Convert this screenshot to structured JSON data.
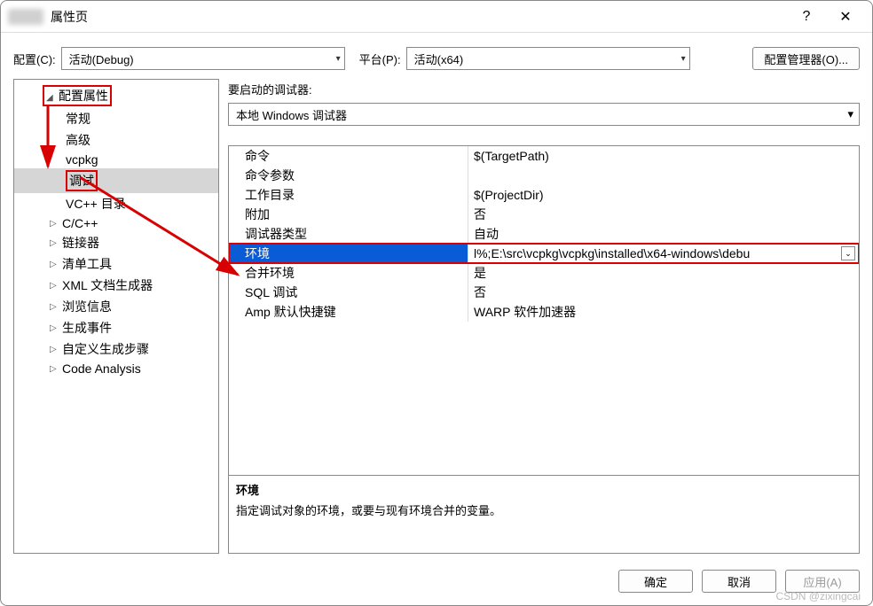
{
  "window": {
    "title": "属性页"
  },
  "toolbar": {
    "config_label": "配置(C):",
    "config_value": "活动(Debug)",
    "platform_label": "平台(P):",
    "platform_value": "活动(x64)",
    "config_mgr": "配置管理器(O)..."
  },
  "tree": {
    "root": "配置属性",
    "items": [
      {
        "label": "常规",
        "expandable": false
      },
      {
        "label": "高级",
        "expandable": false
      },
      {
        "label": "vcpkg",
        "expandable": false
      },
      {
        "label": "调试",
        "expandable": false,
        "selected": true
      },
      {
        "label": "VC++ 目录",
        "expandable": false
      },
      {
        "label": "C/C++",
        "expandable": true
      },
      {
        "label": "链接器",
        "expandable": true
      },
      {
        "label": "清单工具",
        "expandable": true
      },
      {
        "label": "XML 文档生成器",
        "expandable": true
      },
      {
        "label": "浏览信息",
        "expandable": true
      },
      {
        "label": "生成事件",
        "expandable": true
      },
      {
        "label": "自定义生成步骤",
        "expandable": true
      },
      {
        "label": "Code Analysis",
        "expandable": true
      }
    ]
  },
  "right": {
    "launcher_label": "要启动的调试器:",
    "launcher_value": "本地 Windows 调试器",
    "rows": [
      {
        "name": "命令",
        "value": "$(TargetPath)"
      },
      {
        "name": "命令参数",
        "value": ""
      },
      {
        "name": "工作目录",
        "value": "$(ProjectDir)"
      },
      {
        "name": "附加",
        "value": "否"
      },
      {
        "name": "调试器类型",
        "value": "自动"
      },
      {
        "name": "环境",
        "value": "l%;E:\\src\\vcpkg\\vcpkg\\installed\\x64-windows\\debu",
        "selected": true
      },
      {
        "name": "合并环境",
        "value": "是"
      },
      {
        "name": "SQL 调试",
        "value": "否"
      },
      {
        "name": "Amp 默认快捷键",
        "value": "WARP 软件加速器"
      }
    ],
    "desc_title": "环境",
    "desc_text": "指定调试对象的环境，或要与现有环境合并的变量。"
  },
  "buttons": {
    "ok": "确定",
    "cancel": "取消",
    "apply": "应用(A)"
  },
  "watermark": "CSDN @zixingcai"
}
